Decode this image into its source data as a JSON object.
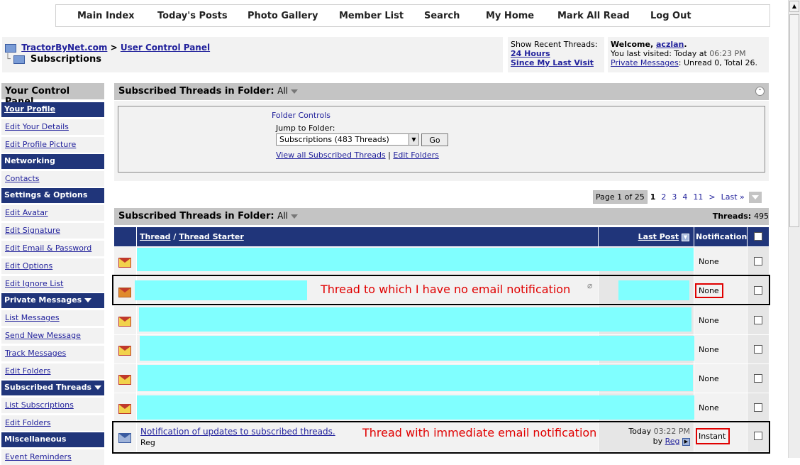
{
  "nav": [
    "Main Index",
    "Today's Posts",
    "Photo Gallery",
    "Member List",
    "Search",
    "My Home",
    "Mark All Read",
    "Log Out"
  ],
  "breadcrumb": {
    "site": "TractorByNet.com",
    "sep": ">",
    "panel": "User Control Panel",
    "current": "Subscriptions"
  },
  "recent": {
    "label": "Show Recent Threads:",
    "link1": "24 Hours",
    "link2": "Since My Last Visit"
  },
  "welcome": {
    "prefix": "Welcome,",
    "user": "aczlan",
    "suffix": ".",
    "last_visit_label": "You last visited: Today at",
    "last_visit_time": "06:23 PM",
    "pm_link": "Private Messages",
    "pm_text": ": Unread 0, Total 26."
  },
  "sidebar": {
    "title": "Your Control Panel",
    "groups": [
      {
        "header": "Your Profile",
        "header_link": true,
        "items": [
          "Edit Your Details",
          "Edit Profile Picture"
        ]
      },
      {
        "header": "Networking",
        "items": [
          "Contacts"
        ]
      },
      {
        "header": "Settings & Options",
        "items": [
          "Edit Avatar",
          "Edit Signature",
          "Edit Email & Password",
          "Edit Options",
          "Edit Ignore List"
        ]
      },
      {
        "header": "Private Messages",
        "dropdown": true,
        "items": [
          "List Messages",
          "Send New Message",
          "Track Messages",
          "Edit Folders"
        ]
      },
      {
        "header": "Subscribed Threads",
        "dropdown": true,
        "items": [
          "List Subscriptions",
          "Edit Folders"
        ]
      },
      {
        "header": "Miscellaneous",
        "items": [
          "Event Reminders"
        ]
      }
    ]
  },
  "folder_panel": {
    "title": "Subscribed Threads in Folder:",
    "folder": "All",
    "controls_title": "Folder Controls",
    "jump_label": "Jump to Folder:",
    "selected": "Subscriptions (483 Threads)",
    "go": "Go",
    "link_view_all": "View all Subscribed Threads",
    "link_sep": "|",
    "link_edit": "Edit Folders"
  },
  "pager": {
    "label": "Page 1 of 25",
    "pages": [
      "1",
      "2",
      "3",
      "4",
      "11",
      ">",
      "Last »"
    ]
  },
  "list": {
    "title": "Subscribed Threads in Folder:",
    "folder": "All",
    "count_label": "Threads:",
    "count": "495",
    "col_thread": "Thread",
    "col_sep": "/",
    "col_starter": "Thread Starter",
    "col_lastpost": "Last Post",
    "col_notification": "Notification"
  },
  "rows": [
    {
      "notification": "None"
    },
    {
      "notification": "None"
    },
    {
      "notification": "None"
    },
    {
      "notification": "None"
    },
    {
      "notification": "None"
    },
    {
      "notification": "None"
    },
    {
      "title": "Notification of updates to subscribed threads.",
      "starter": "Reg",
      "lp_date": "Today",
      "lp_time": "03:22 PM",
      "lp_by": "by",
      "lp_user": "Reg",
      "notification": "Instant"
    }
  ],
  "annotations": {
    "no_email": "Thread to which I have no email notification",
    "immediate": "Thread with immediate email notification"
  }
}
